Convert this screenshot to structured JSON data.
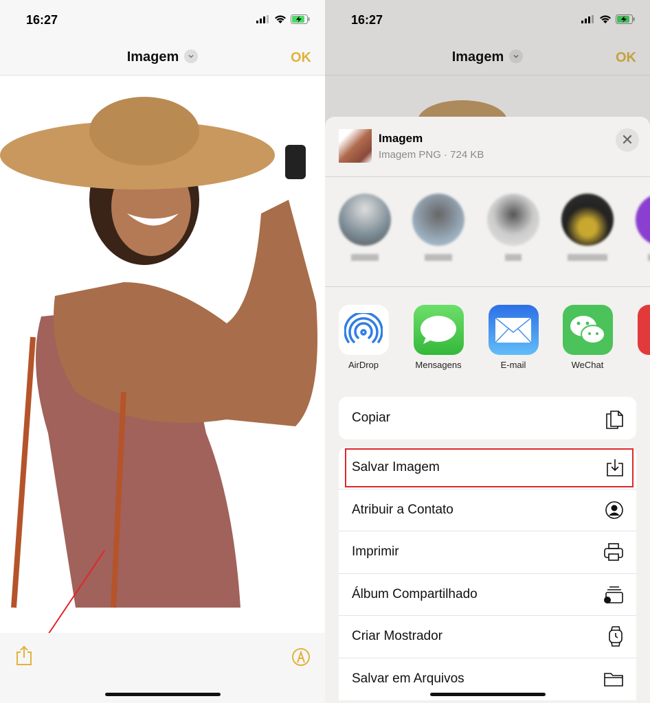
{
  "status_bar": {
    "time": "16:27"
  },
  "nav": {
    "title": "Imagem",
    "done_label": "OK"
  },
  "colors": {
    "accent": "#e0b33c",
    "highlight": "#e0262a",
    "sheet_bg": "#f2f1ef"
  },
  "toolbar": {
    "share_icon": "share-icon",
    "markup_icon": "markup-pen-icon"
  },
  "share_sheet": {
    "title": "Imagem",
    "subtitle": "Imagem PNG · 724 KB",
    "contacts_blurred": 5,
    "apps": [
      {
        "label": "AirDrop",
        "icon": "airdrop-icon"
      },
      {
        "label": "Mensagens",
        "icon": "messages-icon"
      },
      {
        "label": "E-mail",
        "icon": "mail-icon"
      },
      {
        "label": "WeChat",
        "icon": "wechat-icon"
      }
    ],
    "actions_group1": [
      {
        "label": "Copiar",
        "icon": "copy-icon"
      }
    ],
    "actions_group2": [
      {
        "label": "Salvar Imagem",
        "icon": "save-image-icon",
        "highlighted": true
      },
      {
        "label": "Atribuir a Contato",
        "icon": "contact-icon"
      },
      {
        "label": "Imprimir",
        "icon": "printer-icon"
      },
      {
        "label": "Álbum Compartilhado",
        "icon": "shared-album-icon"
      },
      {
        "label": "Criar Mostrador",
        "icon": "watch-icon"
      },
      {
        "label": "Salvar em Arquivos",
        "icon": "folder-icon"
      }
    ]
  }
}
